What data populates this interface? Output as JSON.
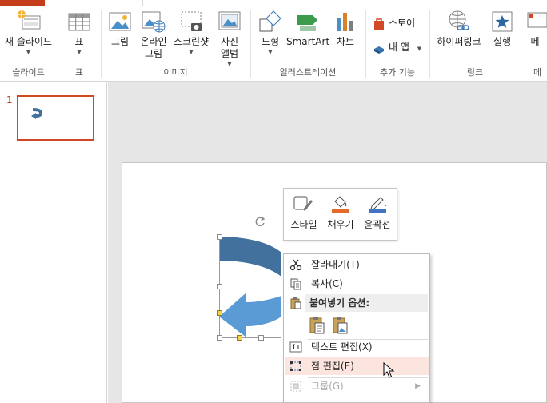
{
  "ribbon": {
    "groups": [
      {
        "label": "슬라이드",
        "buttons": [
          {
            "label": "새 슬라이드"
          }
        ]
      },
      {
        "label": "표",
        "buttons": [
          {
            "label": "표"
          }
        ]
      },
      {
        "label": "이미지",
        "buttons": [
          {
            "label": "그림"
          },
          {
            "label": "온라인",
            "label2": "그림"
          },
          {
            "label": "스크린샷"
          },
          {
            "label": "사진",
            "label2": "앨범"
          }
        ]
      },
      {
        "label": "일러스트레이션",
        "buttons": [
          {
            "label": "도형"
          },
          {
            "label": "SmartArt"
          },
          {
            "label": "차트"
          }
        ]
      },
      {
        "label": "추가 기능",
        "buttons": [
          {
            "label": "스토어"
          },
          {
            "label": "내 앱"
          }
        ]
      },
      {
        "label": "링크",
        "buttons": [
          {
            "label": "하이퍼링크"
          },
          {
            "label": "실행"
          }
        ]
      },
      {
        "label": "메",
        "buttons": [
          {
            "label": "메"
          }
        ]
      }
    ]
  },
  "thumbnail": {
    "number": "1"
  },
  "mini_toolbar": {
    "style_label": "스타일",
    "fill_label": "채우기",
    "outline_label": "윤곽선"
  },
  "context_menu": {
    "cut": "잘라내기(T)",
    "copy": "복사(C)",
    "paste_options": "붙여넣기 옵션:",
    "edit_text": "텍스트 편집(X)",
    "edit_points": "점 편집(E)",
    "group": "그룹(G)"
  },
  "colors": {
    "accent": "#c43e1c",
    "thumb_border": "#d24726",
    "shape_dark": "#41719c",
    "shape_light": "#5b9bd5",
    "highlight": "#fce4df"
  }
}
